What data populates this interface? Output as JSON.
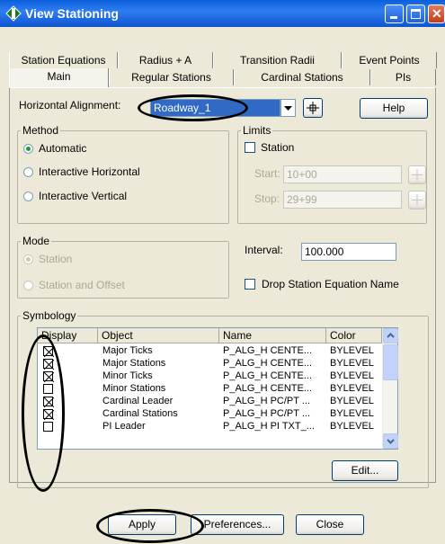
{
  "window": {
    "title": "View Stationing"
  },
  "tabs": {
    "row_back": [
      "Station Equations",
      "Radius + A",
      "Transition Radii",
      "Event Points"
    ],
    "row_front": [
      "Main",
      "Regular Stations",
      "Cardinal Stations",
      "PIs"
    ]
  },
  "alignment": {
    "label": "Horizontal Alignment:",
    "value": "Roadway_1",
    "help": "Help"
  },
  "method": {
    "title": "Method",
    "options": [
      "Automatic",
      "Interactive Horizontal",
      "Interactive Vertical"
    ],
    "selected": "Automatic"
  },
  "limits": {
    "title": "Limits",
    "station_label": "Station",
    "start_label": "Start:",
    "start_value": "10+00",
    "stop_label": "Stop:",
    "stop_value": "29+99"
  },
  "mode": {
    "title": "Mode",
    "options": [
      "Station",
      "Station and Offset"
    ],
    "selected": "Station"
  },
  "interval": {
    "label": "Interval:",
    "value": "100.000"
  },
  "drop_equation": {
    "label": "Drop Station Equation Name"
  },
  "symbology": {
    "title": "Symbology",
    "headers": [
      "Display",
      "Object",
      "Name",
      "Color"
    ],
    "rows": [
      {
        "display": true,
        "object": "Major Ticks",
        "name": "P_ALG_H CENTE...",
        "color": "BYLEVEL"
      },
      {
        "display": true,
        "object": "Major Stations",
        "name": "P_ALG_H CENTE...",
        "color": "BYLEVEL"
      },
      {
        "display": true,
        "object": "Minor Ticks",
        "name": "P_ALG_H CENTE...",
        "color": "BYLEVEL"
      },
      {
        "display": false,
        "object": "Minor Stations",
        "name": "P_ALG_H CENTE...",
        "color": "BYLEVEL"
      },
      {
        "display": true,
        "object": "Cardinal Leader",
        "name": "P_ALG_H PC/PT ...",
        "color": "BYLEVEL"
      },
      {
        "display": true,
        "object": "Cardinal Stations",
        "name": "P_ALG_H PC/PT ...",
        "color": "BYLEVEL"
      },
      {
        "display": false,
        "object": "PI Leader",
        "name": "P_ALG_H PI TXT_...",
        "color": "BYLEVEL"
      }
    ],
    "edit": "Edit..."
  },
  "footer": {
    "apply": "Apply",
    "preferences": "Preferences...",
    "close": "Close"
  },
  "colors": {
    "title_bar": "#0a5fdc",
    "dialog_bg": "#ece9d8",
    "highlight": "#316ac5"
  }
}
